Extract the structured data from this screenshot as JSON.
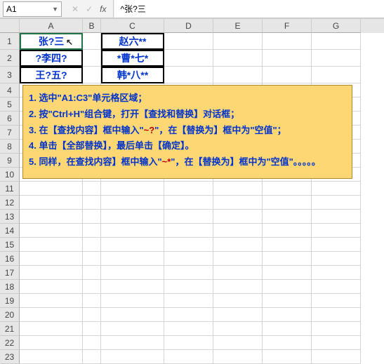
{
  "formula_bar": {
    "name_box": "A1",
    "formula_value": "^张?三"
  },
  "columns": [
    "A",
    "B",
    "C",
    "D",
    "E",
    "F",
    "G"
  ],
  "col_widths": [
    "cA",
    "cB",
    "cC",
    "cD",
    "cE",
    "cF",
    "cG"
  ],
  "row_labels": [
    "1",
    "2",
    "3",
    "4",
    "5",
    "6",
    "7",
    "8",
    "9",
    "10",
    "11",
    "12",
    "13",
    "14",
    "15",
    "16",
    "17",
    "18",
    "19",
    "20",
    "21",
    "22",
    "23"
  ],
  "table": {
    "a": [
      "张?三",
      "?李四?",
      "王?五?"
    ],
    "c": [
      "赵六**",
      "*曹*七*",
      "韩*八**"
    ]
  },
  "instructions": {
    "l1": "1. 选中\"A1:C3\"单元格区域；",
    "l2": "2. 按\"Ctrl+H\"组合键，打开【查找和替换】对话框；",
    "l3a": "3. 在【查找内容】框中输入\"",
    "l3t": "~?",
    "l3b": "\"，在【替换为】框中为\"空值\"；",
    "l4": "4. 单击【全部替换】，最后单击【确定】。",
    "l5a": "5. 同样，在查找内容】框中输入\"",
    "l5t": "~*",
    "l5b": "\"，在【替换为】框中为\"空值\"。。。。。"
  }
}
